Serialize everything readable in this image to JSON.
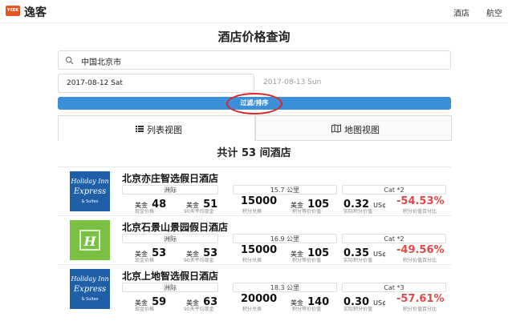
{
  "header": {
    "logo_text": "YEEK",
    "brand": "逸客",
    "nav": [
      "酒店",
      "航空"
    ]
  },
  "page_title": "酒店价格查询",
  "search": {
    "value": "中国北京市"
  },
  "dates": {
    "checkin": "2017-08-12 Sat",
    "checkout": "2017-08-13 Sun"
  },
  "filter_button": "过滤/排序",
  "tabs": {
    "list": "列表视图",
    "map": "地图视图"
  },
  "result_count": "共计 53 间酒店",
  "labels": {
    "cash_price": "现金价格",
    "avg_90": "90天平均现金",
    "points_redeem": "积分兑换",
    "points_equiv": "积分等价价值",
    "points_value": "实际积分价值",
    "save_pct": "积分价值百分比",
    "usd": "美金",
    "cent": "US¢"
  },
  "hotels": [
    {
      "name": "北京亦庄智选假日酒店",
      "brand": "Holiday Inn Express",
      "region": "洲际",
      "distance": "15.7 公里",
      "category": "Cat *2",
      "cash": "48",
      "avg": "51",
      "points": "15000",
      "equiv": "105",
      "cpp": "0.32",
      "pct": "-54.53%"
    },
    {
      "name": "北京石景山景园假日酒店",
      "brand": "Holiday Inn",
      "region": "洲际",
      "distance": "16.9 公里",
      "category": "Cat *2",
      "cash": "53",
      "avg": "53",
      "points": "15000",
      "equiv": "105",
      "cpp": "0.35",
      "pct": "-49.56%"
    },
    {
      "name": "北京上地智选假日酒店",
      "brand": "Holiday Inn Express",
      "region": "洲际",
      "distance": "18.3 公里",
      "category": "Cat *3",
      "cash": "59",
      "avg": "63",
      "points": "20000",
      "equiv": "140",
      "cpp": "0.30",
      "pct": "-57.61%"
    }
  ],
  "colors": {
    "accent": "#3b8fd9",
    "highlight_circle": "#d92626",
    "negative": "#e24a4a",
    "hie_blue": "#1f5fa8",
    "hi_green": "#7ac143"
  },
  "icons": [
    "search-icon",
    "list-icon",
    "map-icon"
  ]
}
